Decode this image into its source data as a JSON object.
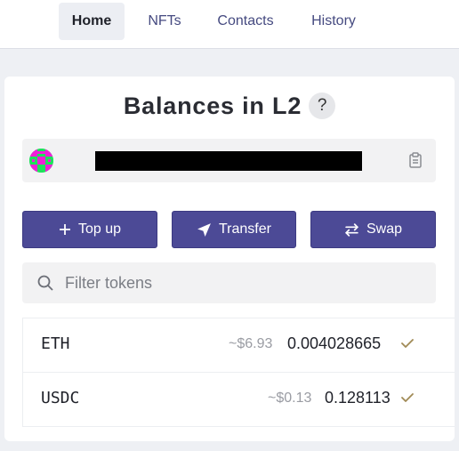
{
  "nav": {
    "tabs": [
      {
        "label": "Home",
        "active": true
      },
      {
        "label": "NFTs",
        "active": false
      },
      {
        "label": "Contacts",
        "active": false
      },
      {
        "label": "History",
        "active": false
      }
    ]
  },
  "balances": {
    "title": "Balances in L2",
    "help_label": "?",
    "address": {
      "avatar_icon": "identicon-avatar",
      "address_redacted": true,
      "copy_icon": "clipboard-icon"
    },
    "actions": {
      "topup_label": "Top up",
      "topup_icon": "plus-icon",
      "transfer_label": "Transfer",
      "transfer_icon": "paper-plane-icon",
      "swap_label": "Swap",
      "swap_icon": "swap-arrows-icon"
    },
    "filter": {
      "placeholder": "Filter tokens",
      "value": ""
    },
    "tokens": [
      {
        "symbol": "ETH",
        "usd": "~$6.93",
        "amount": "0.004028665",
        "verified": true
      },
      {
        "symbol": "USDC",
        "usd": "~$0.13",
        "amount": "0.128113",
        "verified": true
      }
    ]
  },
  "colors": {
    "accent": "#4c4a96",
    "nav_text": "#454a80",
    "check": "#a08a55",
    "page_bg": "#eef0f4"
  }
}
